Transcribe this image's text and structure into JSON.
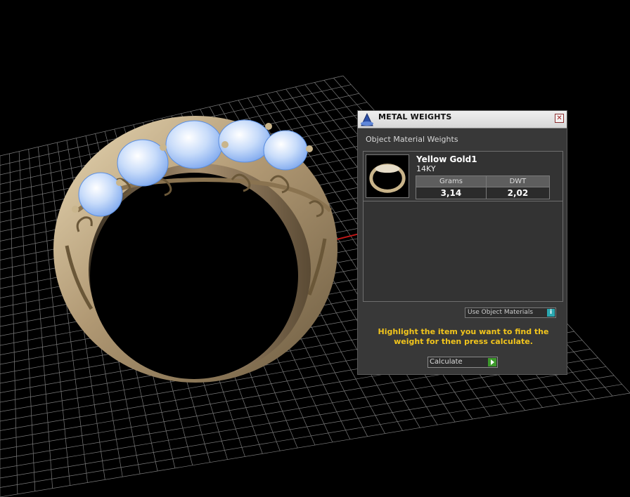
{
  "panel": {
    "title": "METAL WEIGHTS",
    "section_title": "Object Material Weights",
    "item": {
      "name": "Yellow Gold1",
      "type": "14KY",
      "columns": [
        "Grams",
        "DWT"
      ],
      "values": [
        "3,14",
        "2,02"
      ]
    },
    "use_object_materials": "Use Object Materials",
    "hint": "Highlight the item you want to find the weight for then press calculate.",
    "calculate_label": "Calculate"
  },
  "colors": {
    "grid_line": "#7a7a7a",
    "grid_axis_x": "#c01818",
    "grid_axis_y": "#1aa3a3",
    "metal": "#b8a37c",
    "gem": "#9cc4f4",
    "hint_text": "#f2c51c"
  },
  "icons": [
    "rhino-logo-icon",
    "close-icon",
    "info-icon",
    "play-icon"
  ]
}
